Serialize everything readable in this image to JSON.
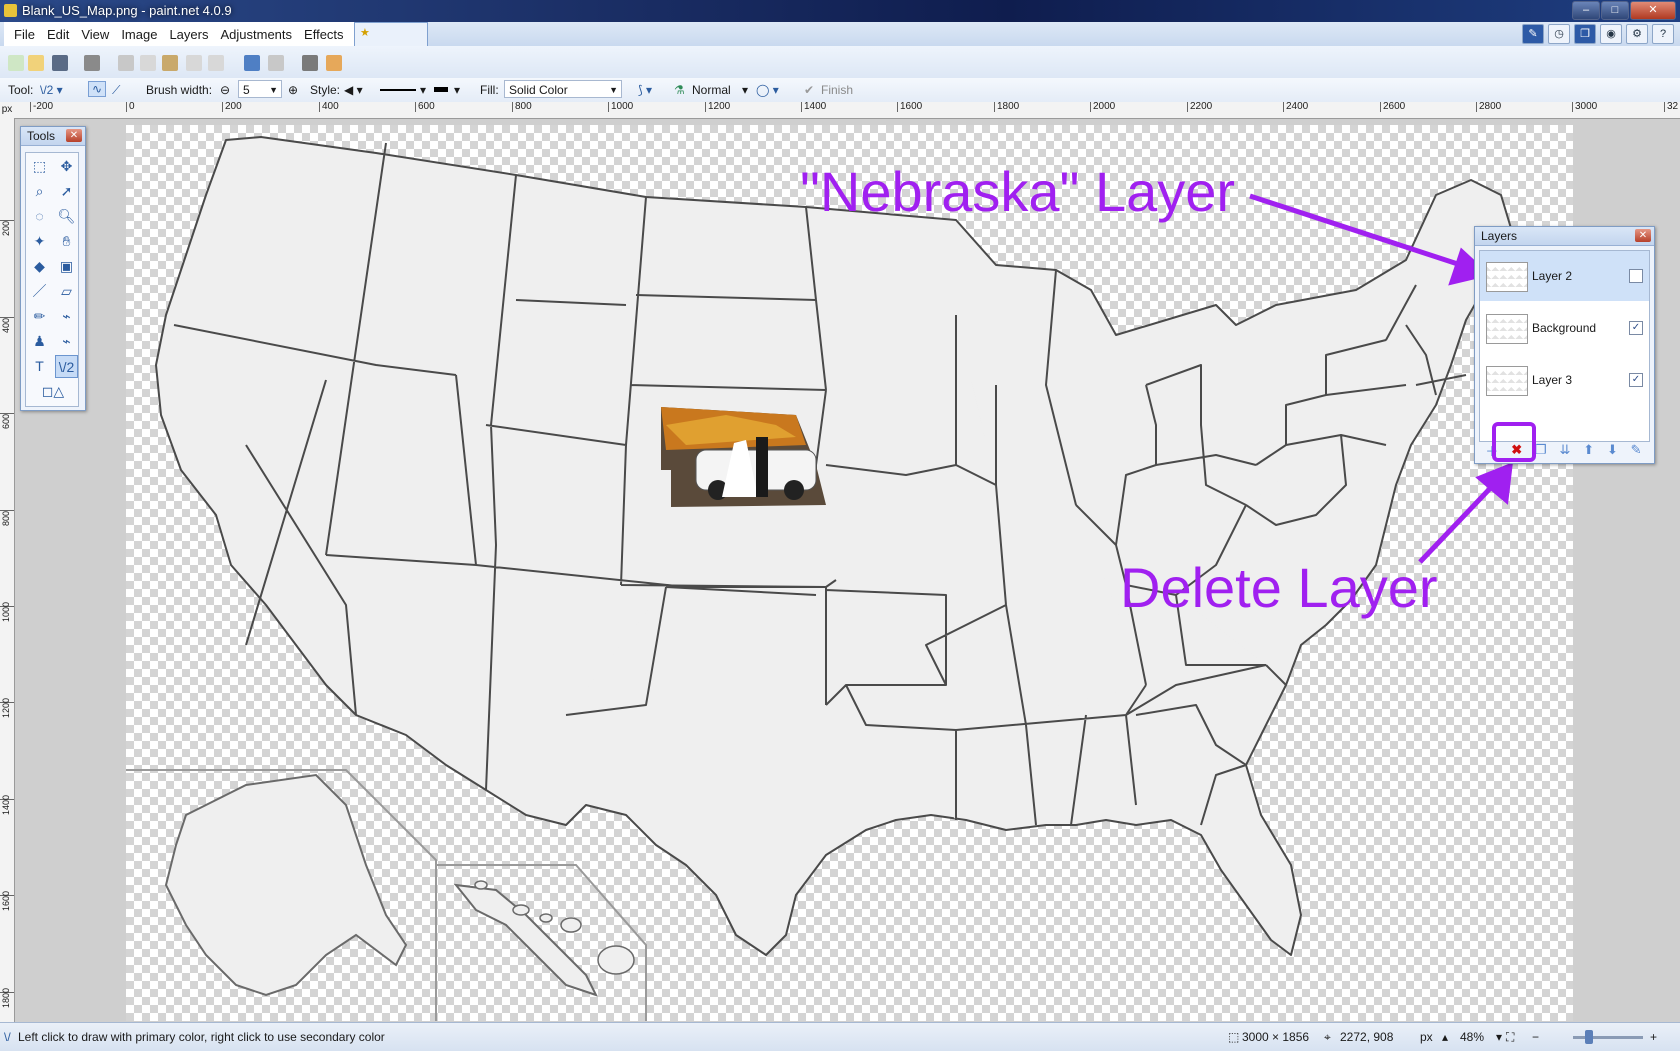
{
  "window": {
    "title": "Blank_US_Map.png - paint.net 4.0.9",
    "min": "–",
    "max": "□",
    "close": "✕"
  },
  "menu": [
    "File",
    "Edit",
    "View",
    "Image",
    "Layers",
    "Adjustments",
    "Effects"
  ],
  "toolbar": {
    "tool_label": "Tool:",
    "brush_width_label": "Brush width:",
    "brush_width_value": "5",
    "style_label": "Style:",
    "fill_label": "Fill:",
    "fill_value": "Solid Color",
    "blend_value": "Normal",
    "finish_label": "Finish"
  },
  "ruler": {
    "unit": "px",
    "h_ticks": [
      "-200",
      "0",
      "200",
      "400",
      "600",
      "800",
      "1000",
      "1200",
      "1400",
      "1600",
      "1800",
      "2000",
      "2200",
      "2400",
      "2600",
      "2800",
      "3000",
      "32"
    ],
    "v_ticks": [
      "200",
      "400",
      "600",
      "800",
      "1000",
      "1200",
      "1400",
      "1600",
      "1800"
    ]
  },
  "tools_panel": {
    "title": "Tools",
    "close": "✕"
  },
  "layers_panel": {
    "title": "Layers",
    "close": "✕",
    "layers": [
      {
        "name": "Layer 2",
        "visible": false,
        "selected": true
      },
      {
        "name": "Background",
        "visible": true,
        "selected": false
      },
      {
        "name": "Layer 3",
        "visible": true,
        "selected": false
      }
    ]
  },
  "annotations": {
    "nebraska": "\"Nebraska\" Layer",
    "delete": "Delete Layer",
    "color": "#a020f0"
  },
  "statusbar": {
    "hint": "Left click to draw with primary color, right click to use secondary color",
    "image_size": "3000 × 1856",
    "cursor": "2272, 908",
    "unit": "px",
    "zoom": "48%"
  }
}
